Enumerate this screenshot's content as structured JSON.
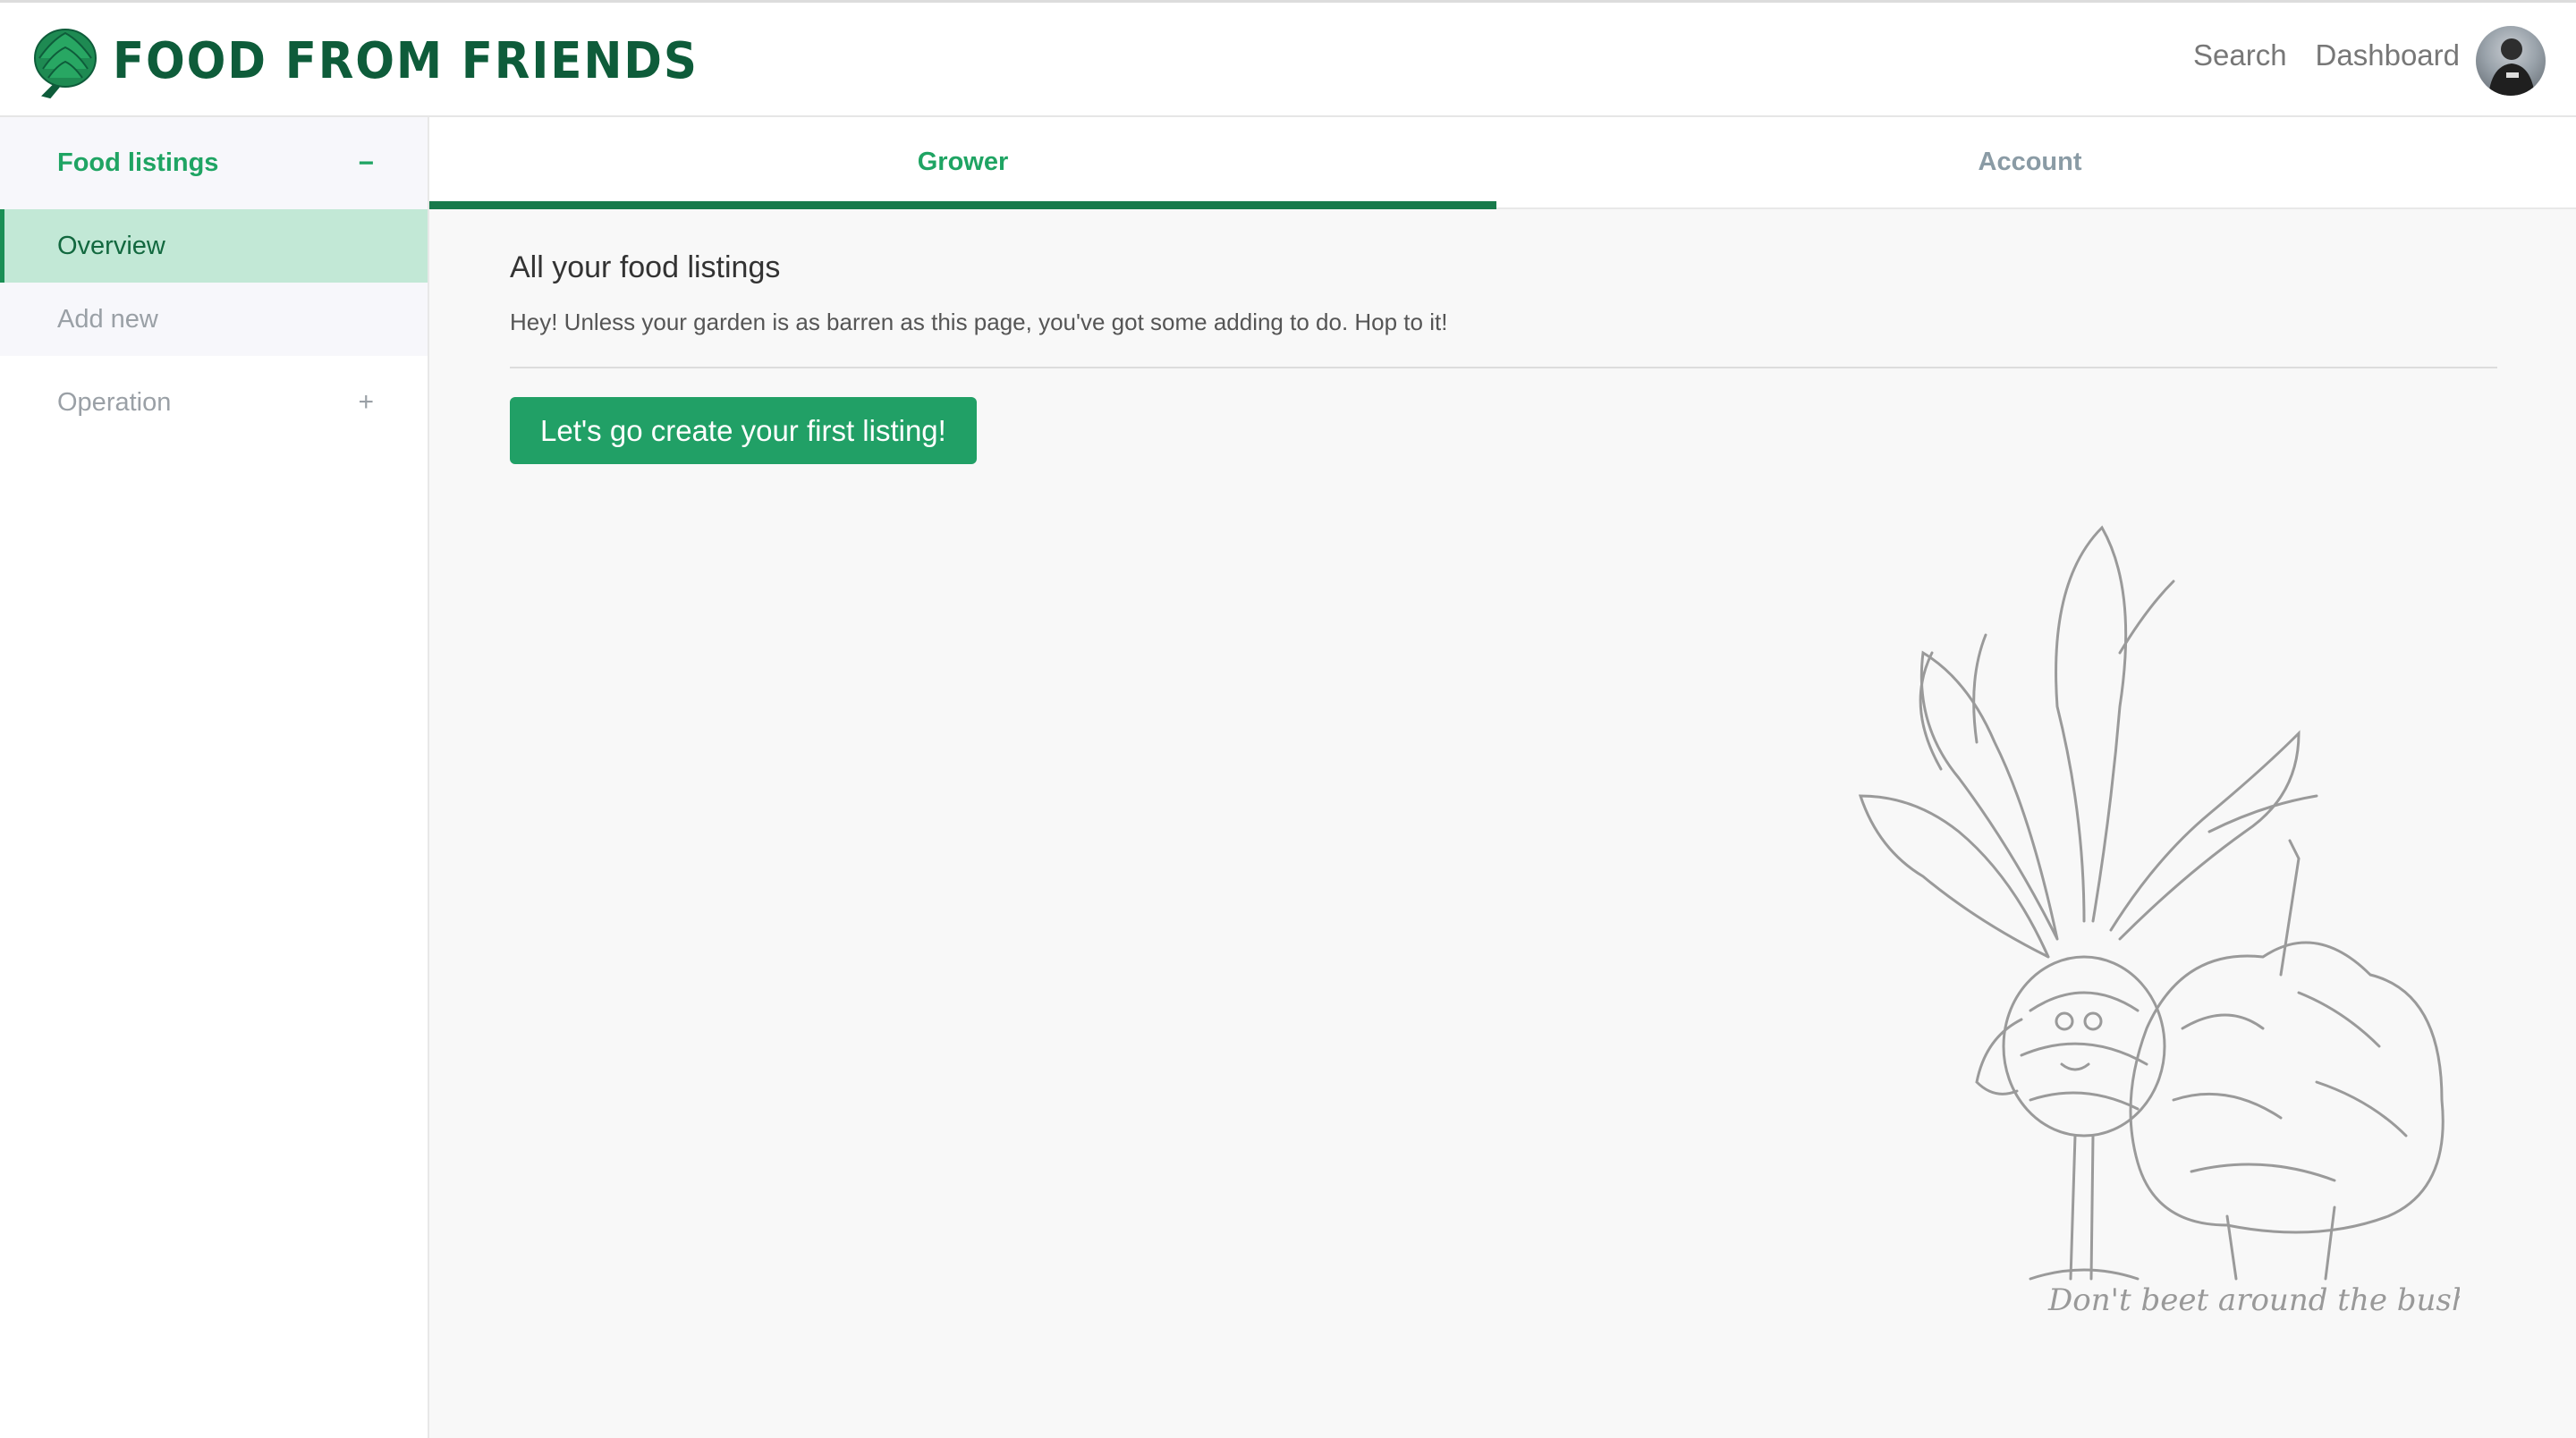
{
  "brand": {
    "name": "FOOD FROM FRIENDS",
    "logo_icon": "artichoke-icon",
    "color": "#0e5c3a"
  },
  "nav": {
    "search": "Search",
    "dashboard": "Dashboard"
  },
  "sidebar": {
    "section_title": "Food listings",
    "section_toggle": "−",
    "items": [
      {
        "label": "Overview",
        "active": true
      },
      {
        "label": "Add new",
        "active": false
      }
    ],
    "operation": {
      "label": "Operation",
      "toggle": "+"
    }
  },
  "tabs": [
    {
      "label": "Grower",
      "active": true
    },
    {
      "label": "Account",
      "active": false
    }
  ],
  "main": {
    "heading": "All your food listings",
    "subtext": "Hey! Unless your garden is as barren as this page, you've got some adding to do. Hop to it!",
    "cta_label": "Let's go create your first listing!"
  },
  "illustration": {
    "caption": "Don't beet around the bush",
    "icon": "beet-and-bush-illustration"
  },
  "colors": {
    "accent": "#1fa463",
    "button": "#21a066",
    "active_bg": "#c2e8d6",
    "tab_underline": "#177a4b"
  }
}
